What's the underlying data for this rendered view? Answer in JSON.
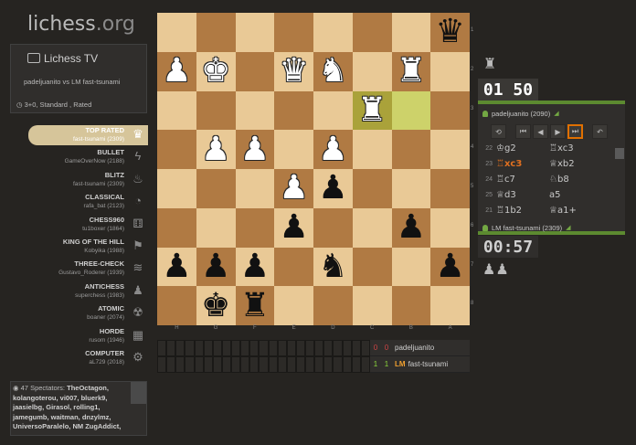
{
  "logo": {
    "main": "lichess",
    "org": ".org"
  },
  "tv": {
    "title": "Lichess TV",
    "players": "padeljuanito vs LM fast-tsunami",
    "mode": "3+0, Standard , Rated"
  },
  "channels": [
    {
      "name": "TOP RATED",
      "player": "fast-tsunami (2309)",
      "icon": "♛",
      "active": true
    },
    {
      "name": "BULLET",
      "player": "GameOverNow (2188)",
      "icon": "ϟ",
      "active": false
    },
    {
      "name": "BLITZ",
      "player": "fast-tsunami (2309)",
      "icon": "♨",
      "active": false
    },
    {
      "name": "CLASSICAL",
      "player": "rafa_bat (2123)",
      "icon": "◔",
      "active": false
    },
    {
      "name": "CHESS960",
      "player": "tu1boxer (1864)",
      "icon": "⚅",
      "active": false
    },
    {
      "name": "KING OF THE HILL",
      "player": "Kobyika (1988)",
      "icon": "⚑",
      "active": false
    },
    {
      "name": "THREE-CHECK",
      "player": "Gustavo_Roderer (1939)",
      "icon": "≋",
      "active": false
    },
    {
      "name": "ANTICHESS",
      "player": "superchess (1983)",
      "icon": "♟",
      "active": false
    },
    {
      "name": "ATOMIC",
      "player": "boaner (2074)",
      "icon": "☢",
      "active": false
    },
    {
      "name": "HORDE",
      "player": "rusom (1946)",
      "icon": "▦",
      "active": false
    },
    {
      "name": "COMPUTER",
      "player": "aL729 (2018)",
      "icon": "⚙",
      "active": false
    }
  ],
  "spectators": {
    "label": "47 Spectators:",
    "names": "TheOctagon, kolangoterou, vi007, bluerk9, jaasielbg, Girasol, rolling1, jamegumb, waitman, dnzylmz, UniversoParalelo, NM ZugAddict,"
  },
  "board": {
    "rows": [
      [
        "",
        "",
        "",
        "",
        "",
        "",
        "",
        "bq"
      ],
      [
        "wp",
        "wk",
        "",
        "wq",
        "wn",
        "",
        "wr",
        ""
      ],
      [
        "",
        "",
        "",
        "",
        "",
        "wr",
        "",
        ""
      ],
      [
        "",
        "wp",
        "wp",
        "",
        "wp",
        "",
        "",
        ""
      ],
      [
        "",
        "",
        "",
        "wp",
        "bp",
        "",
        "",
        ""
      ],
      [
        "",
        "",
        "",
        "bp",
        "",
        "",
        "bp",
        ""
      ],
      [
        "bp",
        "bp",
        "bp",
        "",
        "bn",
        "",
        "",
        "bp"
      ],
      [
        "",
        "bk",
        "br",
        "",
        "",
        "",
        "",
        ""
      ]
    ],
    "highlight": [
      [
        2,
        5
      ],
      [
        2,
        6
      ]
    ],
    "files": [
      "H",
      "G",
      "F",
      "E",
      "D",
      "C",
      "B",
      "A"
    ],
    "ranks": [
      "1",
      "2",
      "3",
      "4",
      "5",
      "6",
      "7",
      "8"
    ]
  },
  "results": [
    {
      "s1": "0",
      "s2": "0",
      "color": "red",
      "title": "",
      "name": "padeljuanito"
    },
    {
      "s1": "1",
      "s2": "1",
      "color": "grn",
      "title": "LM",
      "name": "fast-tsunami"
    }
  ],
  "right": {
    "top_capture": "♜",
    "top_clock": "01 50",
    "top_player": "padeljuanito (2090)",
    "bottom_player": "LM fast-tsunami (2309)",
    "bottom_clock": "00:57",
    "bottom_capture": "♟♟",
    "controls": [
      "⟲",
      "⏮",
      "◀",
      "▶",
      "⏭",
      "↶"
    ],
    "moves": [
      {
        "n": "21",
        "w": "♖1b2",
        "b": "♕a1+"
      },
      {
        "n": "22",
        "w": "♔g2",
        "b": "♖xc3"
      },
      {
        "n": "23",
        "w": "♖xc3",
        "b": "♕xb2",
        "cur": "w"
      },
      {
        "n": "24",
        "w": "♖c7",
        "b": "♘b8"
      },
      {
        "n": "25",
        "w": "♕d3",
        "b": "a5"
      }
    ]
  }
}
